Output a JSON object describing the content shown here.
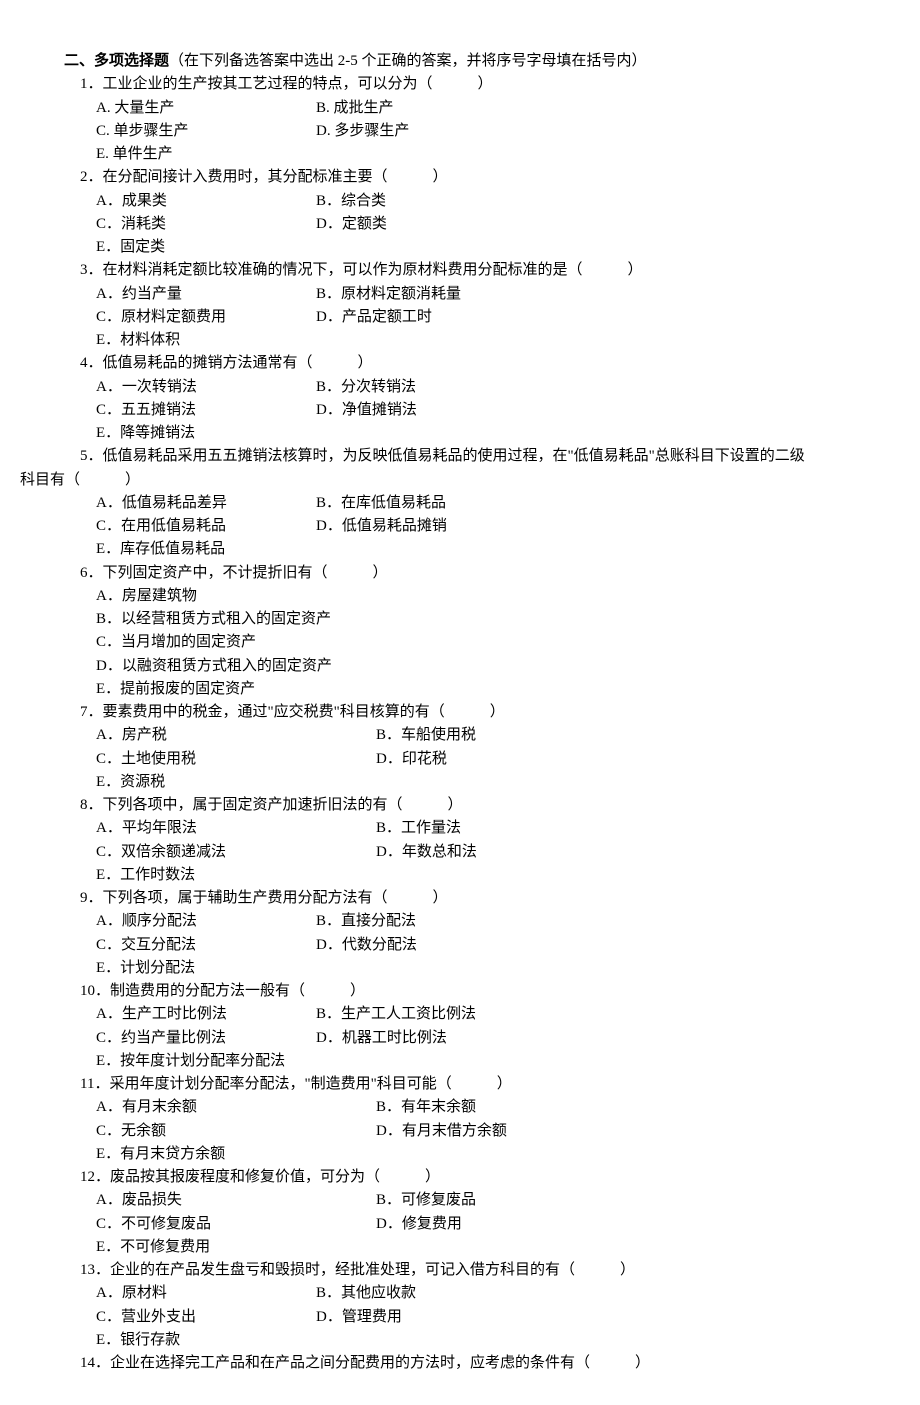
{
  "section": {
    "title": "二、多项选择题",
    "desc": "（在下列备选答案中选出 2-5 个正确的答案，并将序号字母填在括号内）"
  },
  "q1": {
    "text": "1．工业企业的生产按其工艺过程的特点，可以分为（　　　）",
    "a": "A. 大量生产",
    "b": "B. 成批生产",
    "c": "C. 单步骤生产",
    "d": "D. 多步骤生产",
    "e": "E. 单件生产"
  },
  "q2": {
    "text": "2．在分配间接计入费用时，其分配标准主要（　　　）",
    "a": "A．成果类",
    "b": "B．综合类",
    "c": "C．消耗类",
    "d": "D．定额类",
    "e": "E．固定类"
  },
  "q3": {
    "text": "3．在材料消耗定额比较准确的情况下，可以作为原材料费用分配标准的是（　　　）",
    "a": "A．约当产量",
    "b": "B．原材料定额消耗量",
    "c": "C．原材料定额费用",
    "d": "D．产品定额工时",
    "e": "E．材料体积"
  },
  "q4": {
    "text": "4．低值易耗品的摊销方法通常有（　　　）",
    "a": "A．一次转销法",
    "b": "B．分次转销法",
    "c": "C．五五摊销法",
    "d": "D．净值摊销法",
    "e": "E．降等摊销法"
  },
  "q5": {
    "text_l1": "5．低值易耗品采用五五摊销法核算时，为反映低值易耗品的使用过程，在\"低值易耗品\"总账科目下设置的二级",
    "text_l2": "科目有（　　　）",
    "a": "A．低值易耗品差异",
    "b": "B．在库低值易耗品",
    "c": "C．在用低值易耗品",
    "d": "D．低值易耗品摊销",
    "e": "E．库存低值易耗品"
  },
  "q6": {
    "text": "6．下列固定资产中，不计提折旧有（　　　）",
    "a": "A．房屋建筑物",
    "b": "B．以经营租赁方式租入的固定资产",
    "c": "C．当月增加的固定资产",
    "d": "D．以融资租赁方式租入的固定资产",
    "e": "E．提前报废的固定资产"
  },
  "q7": {
    "text": "7．要素费用中的税金，通过\"应交税费\"科目核算的有（　　　）",
    "a": "A．房产税",
    "b": "B．车船使用税",
    "c": "C．土地使用税",
    "d": "D．印花税",
    "e": "E．资源税"
  },
  "q8": {
    "text": "8．下列各项中，属于固定资产加速折旧法的有（　　　）",
    "a": "A．平均年限法",
    "b": "B．工作量法",
    "c": "C．双倍余额递减法",
    "d": "D．年数总和法",
    "e": "E．工作时数法"
  },
  "q9": {
    "text": "9．下列各项，属于辅助生产费用分配方法有（　　　）",
    "a": "A．顺序分配法",
    "b": "B．直接分配法",
    "c": "C．交互分配法",
    "d": "D．代数分配法",
    "e": "E．计划分配法"
  },
  "q10": {
    "text": "10．制造费用的分配方法一般有（　　　）",
    "a": "A．生产工时比例法",
    "b": "B．生产工人工资比例法",
    "c": "C．约当产量比例法",
    "d": "D．机器工时比例法",
    "e": "E．按年度计划分配率分配法"
  },
  "q11": {
    "text": "11．采用年度计划分配率分配法，\"制造费用\"科目可能（　　　）",
    "a": "A．有月末余额",
    "b": "B．有年末余额",
    "c": "C．无余额",
    "d": "D．有月末借方余额",
    "e": "E．有月末贷方余额"
  },
  "q12": {
    "text": "12．废品按其报废程度和修复价值，可分为（　　　）",
    "a": "A．废品损失",
    "b": "B．可修复废品",
    "c": "C．不可修复废品",
    "d": "D．修复费用",
    "e": "E．不可修复费用"
  },
  "q13": {
    "text": "13．企业的在产品发生盘亏和毁损时，经批准处理，可记入借方科目的有（　　　）",
    "a": "A．原材料",
    "b": "B．其他应收款",
    "c": "C．营业外支出",
    "d": "D．管理费用",
    "e": "E．银行存款"
  },
  "q14": {
    "text": "14．企业在选择完工产品和在产品之间分配费用的方法时，应考虑的条件有（　　　）"
  }
}
